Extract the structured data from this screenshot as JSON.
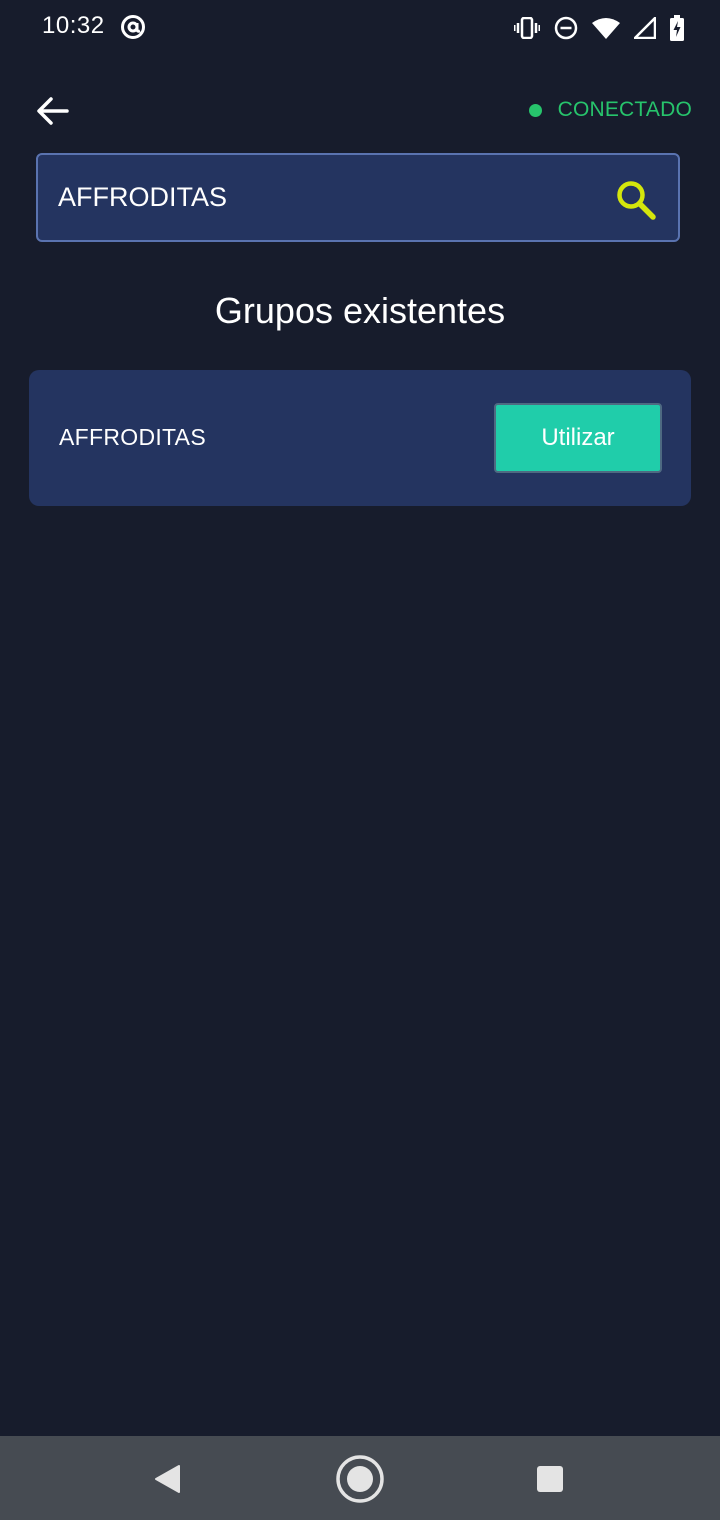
{
  "status_bar": {
    "time": "10:32",
    "icons": [
      "at-sign-icon",
      "vibrate-icon",
      "do-not-disturb-icon",
      "wifi-icon",
      "signal-icon",
      "battery-charging-icon"
    ]
  },
  "header": {
    "back_icon": "arrow-left-icon",
    "connection_status": "CONECTADO",
    "connection_color": "#27c46c"
  },
  "search": {
    "value": "AFFRODITAS",
    "icon": "search-icon",
    "icon_color": "#d4e60c"
  },
  "main": {
    "title": "Grupos existentes",
    "groups": [
      {
        "name": "AFFRODITAS",
        "action_label": "Utilizar"
      }
    ]
  },
  "colors": {
    "background": "#171c2c",
    "card": "#243460",
    "accent_button": "#20cdaa",
    "nav_bar": "#464b52"
  },
  "nav_bar": {
    "buttons": [
      "back-triangle-icon",
      "home-circle-icon",
      "recents-square-icon"
    ]
  }
}
